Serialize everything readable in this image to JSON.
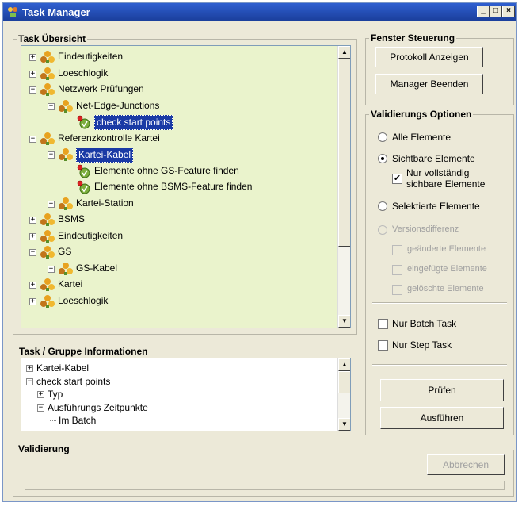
{
  "window": {
    "title": "Task Manager",
    "controls": {
      "minimize": "_",
      "maximize": "□",
      "close": "×"
    }
  },
  "task_overview": {
    "title": "Task Übersicht",
    "items": [
      {
        "label": "Eindeutigkeiten",
        "expander": "+",
        "icon": "task-group-icon"
      },
      {
        "label": "Loeschlogik",
        "expander": "+",
        "icon": "task-group-icon"
      },
      {
        "label": "Netzwerk Prüfungen",
        "expander": "−",
        "icon": "task-group-icon"
      },
      {
        "label": "Net-Edge-Junctions",
        "expander": "−",
        "icon": "task-group-icon"
      },
      {
        "label": "check start points",
        "expander": "",
        "icon": "check-task-icon",
        "selected": true
      },
      {
        "label": "Referenzkontrolle Kartei",
        "expander": "−",
        "icon": "task-group-icon"
      },
      {
        "label": "Kartei-Kabel",
        "expander": "−",
        "icon": "task-group-icon",
        "selected": true
      },
      {
        "label": "Elemente ohne GS-Feature finden",
        "expander": "",
        "icon": "check-task-icon"
      },
      {
        "label": "Elemente ohne BSMS-Feature finden",
        "expander": "",
        "icon": "check-task-icon"
      },
      {
        "label": "Kartei-Station",
        "expander": "+",
        "icon": "task-group-icon"
      },
      {
        "label": "BSMS",
        "expander": "+",
        "icon": "task-group-icon"
      },
      {
        "label": "Eindeutigkeiten",
        "expander": "+",
        "icon": "task-group-icon"
      },
      {
        "label": "GS",
        "expander": "−",
        "icon": "task-group-icon"
      },
      {
        "label": "GS-Kabel",
        "expander": "+",
        "icon": "task-group-icon"
      },
      {
        "label": "Kartei",
        "expander": "+",
        "icon": "task-group-icon"
      },
      {
        "label": "Loeschlogik",
        "expander": "+",
        "icon": "task-group-icon"
      }
    ]
  },
  "task_info": {
    "title": "Task / Gruppe Informationen",
    "items": [
      {
        "label": "Kartei-Kabel",
        "expander": "+"
      },
      {
        "label": "check start points",
        "expander": "−"
      },
      {
        "label": "Typ",
        "expander": "+"
      },
      {
        "label": "Ausführungs Zeitpunkte",
        "expander": "−"
      },
      {
        "label": "Im Batch",
        "expander": ""
      }
    ]
  },
  "window_control": {
    "title": "Fenster Steuerung",
    "protocol_button": "Protokoll Anzeigen",
    "exit_button": "Manager Beenden"
  },
  "validation_options": {
    "title": "Validierungs Optionen",
    "all_elements": "Alle Elemente",
    "visible_elements": "Sichtbare Elemente",
    "fully_visible": "Nur vollständig sichbare Elemente",
    "fully_visible_line1": "Nur vollständig",
    "fully_visible_line2": "sichbare Elemente",
    "selected_elements": "Selektierte Elemente",
    "version_diff": "Versionsdifferenz",
    "changed": "geänderte Elemente",
    "inserted": "eingefügte Elemente",
    "deleted": "gelöschte Elemente",
    "batch_only": "Nur Batch Task",
    "step_only": "Nur Step Task",
    "check_mark": "✔",
    "check_button": "Prüfen",
    "run_button": "Ausführen"
  },
  "validation": {
    "title": "Validierung",
    "cancel_button": "Abbrechen",
    "progress": 0
  },
  "colors": {
    "tree_background": "#eaf3cc",
    "selection": "#1a3aa5",
    "title_bar": "#2f5fd0"
  }
}
